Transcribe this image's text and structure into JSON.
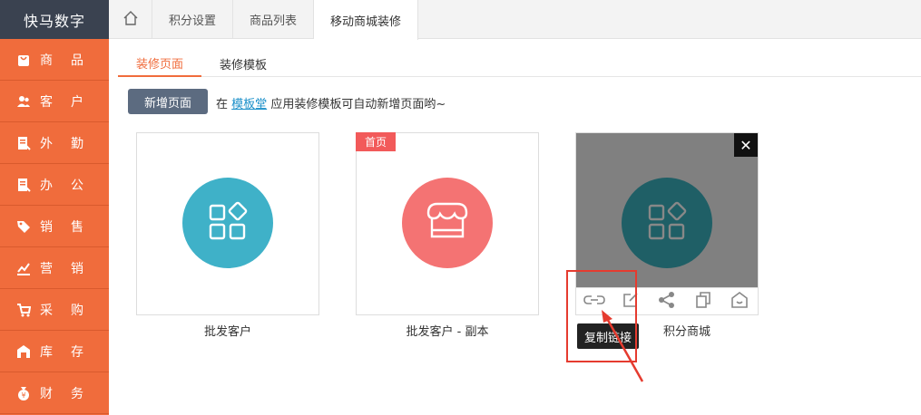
{
  "app": {
    "brand": "快马数字"
  },
  "sidebar": {
    "items": [
      {
        "label": "商品",
        "icon": "bag-icon"
      },
      {
        "label": "客户",
        "icon": "users-icon"
      },
      {
        "label": "外勤",
        "icon": "clipboard-icon"
      },
      {
        "label": "办公",
        "icon": "clipboard-icon"
      },
      {
        "label": "销售",
        "icon": "tag-icon"
      },
      {
        "label": "营销",
        "icon": "chart-icon"
      },
      {
        "label": "采购",
        "icon": "cart-icon"
      },
      {
        "label": "库存",
        "icon": "warehouse-icon"
      },
      {
        "label": "财务",
        "icon": "money-bag-icon"
      }
    ]
  },
  "tabs": [
    {
      "label": "积分设置"
    },
    {
      "label": "商品列表"
    },
    {
      "label": "移动商城装修"
    }
  ],
  "subtabs": [
    {
      "label": "装修页面"
    },
    {
      "label": "装修模板"
    }
  ],
  "actions": {
    "new_page": "新增页面",
    "hint_prefix": "在",
    "hint_link": "模板堂",
    "hint_suffix": "应用装修模板可自动新增页面哟~"
  },
  "cards": [
    {
      "label": "批发客户",
      "color": "#3fb1c8"
    },
    {
      "label": "批发客户 - 副本",
      "color": "#f47373",
      "badge": "首页"
    },
    {
      "label": "积分商城",
      "color": "#1f5f66"
    }
  ],
  "tooltip": {
    "text": "复制链接"
  },
  "colors": {
    "accent": "#f06c3c",
    "sidebar_dark": "#3a4250"
  }
}
